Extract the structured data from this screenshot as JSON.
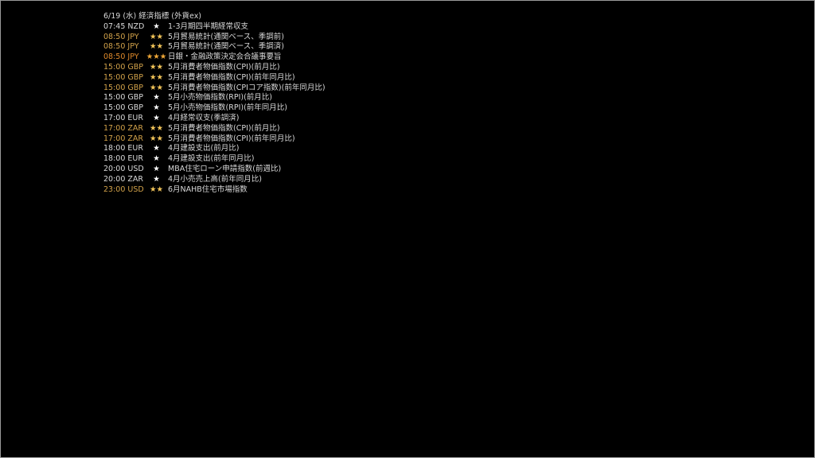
{
  "title": "6/19 (水) 経済指標 (外貨ex)",
  "rows": [
    {
      "time": "07:45 NZD",
      "stars": "★",
      "event": "1-3月期四半期経常収支",
      "level": "white"
    },
    {
      "time": "08:50 JPY",
      "stars": "★★",
      "event": "5月貿易統計(通関ベース、季調前)",
      "level": "gold"
    },
    {
      "time": "08:50 JPY",
      "stars": "★★",
      "event": "5月貿易統計(通関ベース、季調済)",
      "level": "gold"
    },
    {
      "time": "08:50 JPY",
      "stars": "★★★",
      "event": "日銀・金融政策決定会合議事要旨",
      "level": "orange"
    },
    {
      "time": "15:00 GBP",
      "stars": "★★",
      "event": "5月消費者物価指数(CPI)(前月比)",
      "level": "gold"
    },
    {
      "time": "15:00 GBP",
      "stars": "★★",
      "event": "5月消費者物価指数(CPI)(前年同月比)",
      "level": "gold"
    },
    {
      "time": "15:00 GBP",
      "stars": "★★",
      "event": "5月消費者物価指数(CPIコア指数)(前年同月比)",
      "level": "gold"
    },
    {
      "time": "15:00 GBP",
      "stars": "★",
      "event": "5月小売物価指数(RPI)(前月比)",
      "level": "white"
    },
    {
      "time": "15:00 GBP",
      "stars": "★",
      "event": "5月小売物価指数(RPI)(前年同月比)",
      "level": "white"
    },
    {
      "time": "17:00 EUR",
      "stars": "★",
      "event": "4月経常収支(季調済)",
      "level": "white"
    },
    {
      "time": "17:00 ZAR",
      "stars": "★★",
      "event": "5月消費者物価指数(CPI)(前月比)",
      "level": "gold"
    },
    {
      "time": "17:00 ZAR",
      "stars": "★★",
      "event": "5月消費者物価指数(CPI)(前年同月比)",
      "level": "gold"
    },
    {
      "time": "18:00 EUR",
      "stars": "★",
      "event": "4月建設支出(前月比)",
      "level": "white"
    },
    {
      "time": "18:00 EUR",
      "stars": "★",
      "event": "4月建設支出(前年同月比)",
      "level": "white"
    },
    {
      "time": "20:00 USD",
      "stars": "★",
      "event": "MBA住宅ローン申請指数(前週比)",
      "level": "white"
    },
    {
      "time": "20:00 ZAR",
      "stars": "★",
      "event": "4月小売売上高(前年同月比)",
      "level": "white"
    },
    {
      "time": "23:00 USD",
      "stars": "★★",
      "event": "6月NAHB住宅市場指数",
      "level": "gold"
    }
  ],
  "colors": {
    "white_text": "#d9d9d9",
    "gold_text": "#d2a24a",
    "orange_text": "#e08a2a",
    "border": "#9a9a9a",
    "background": "#000000"
  }
}
